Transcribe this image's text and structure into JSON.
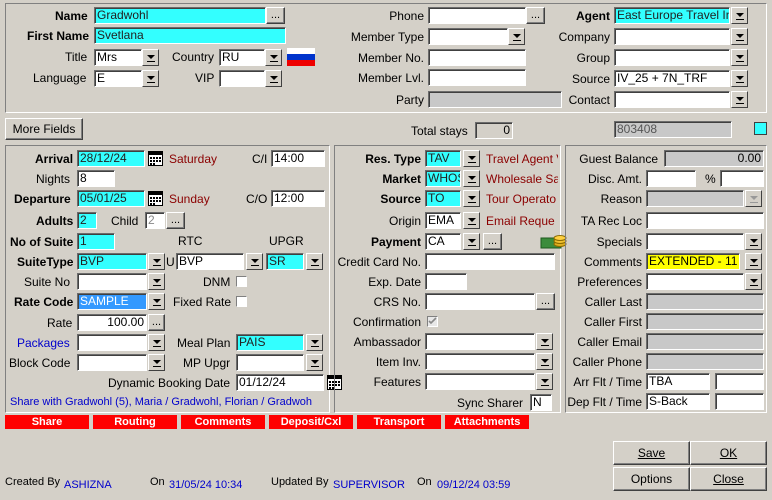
{
  "top": {
    "name_label": "Name",
    "name_value": "Gradwohl",
    "firstname_label": "First Name",
    "firstname_value": "Svetlana",
    "title_label": "Title",
    "title_value": "Mrs",
    "country_label": "Country",
    "country_value": "RU",
    "language_label": "Language",
    "language_value": "E",
    "vip_label": "VIP",
    "vip_value": "",
    "phone_label": "Phone",
    "phone_value": "",
    "membertype_label": "Member Type",
    "membertype_value": "",
    "memberno_label": "Member No.",
    "memberno_value": "",
    "memberlvl_label": "Member Lvl.",
    "memberlvl_value": "",
    "party_label": "Party",
    "party_value": "",
    "agent_label": "Agent",
    "agent_value": "East Europe Travel In",
    "company_label": "Company",
    "company_value": "",
    "group_label": "Group",
    "group_value": "",
    "source_label": "Source",
    "source_value": "IV_25 + 7N_TRF",
    "contact_label": "Contact",
    "contact_value": "",
    "ellipsis": "..."
  },
  "strip": {
    "more_fields": "More Fields",
    "total_stays_label": "Total stays",
    "total_stays_value": "0",
    "res_number": "803408"
  },
  "left": {
    "arrival_label": "Arrival",
    "arrival_value": "28/12/24",
    "arrival_day": "Saturday",
    "ci_label": "C/I",
    "ci_value": "14:00",
    "nights_label": "Nights",
    "nights_value": "8",
    "departure_label": "Departure",
    "departure_value": "05/01/25",
    "departure_day": "Sunday",
    "co_label": "C/O",
    "co_value": "12:00",
    "adults_label": "Adults",
    "adults_value": "2",
    "child_label": "Child",
    "child_value": "2",
    "noofsuite_label": "No of Suite",
    "noofsuite_value": "1",
    "rtc_label": "RTC",
    "upgr_label": "UPGR",
    "suitetype_label": "SuiteType",
    "suitetype_value": "BVP",
    "u_label": "U",
    "rtc_value": "BVP",
    "upgr_value": "SR",
    "suiteno_label": "Suite No",
    "suiteno_value": "",
    "dnm_label": "DNM",
    "ratecode_label": "Rate Code",
    "ratecode_value": "SAMPLE",
    "fixedrate_label": "Fixed Rate",
    "rate_label": "Rate",
    "rate_value": "100.00",
    "packages_label": "Packages",
    "packages_value": "",
    "mealplan_label": "Meal Plan",
    "mealplan_value": "PAIS",
    "blockcode_label": "Block Code",
    "blockcode_value": "",
    "mpupgr_label": "MP Upgr",
    "mpupgr_value": "",
    "dynbooking_label": "Dynamic Booking Date",
    "dynbooking_value": "01/12/24",
    "share_text": "Share with Gradwohl (5), Maria / Gradwohl, Florian / Gradwoh"
  },
  "middle": {
    "restype_label": "Res. Type",
    "restype_value": "TAV",
    "restype_desc": "Travel Agent V",
    "market_label": "Market",
    "market_value": "WHOS",
    "market_desc": "Wholesale Sa",
    "source_label": "Source",
    "source_value": "TO",
    "source_desc": "Tour Operato",
    "origin_label": "Origin",
    "origin_value": "EMA",
    "origin_desc": "Email Reque",
    "payment_label": "Payment",
    "payment_value": "CA",
    "creditcard_label": "Credit Card No.",
    "creditcard_value": "",
    "expdate_label": "Exp. Date",
    "expdate_value": "",
    "crsno_label": "CRS No.",
    "crsno_value": "",
    "confirmation_label": "Confirmation",
    "ambassador_label": "Ambassador",
    "ambassador_value": "",
    "iteminv_label": "Item Inv.",
    "iteminv_value": "",
    "features_label": "Features",
    "features_value": "",
    "syncsharer_label": "Sync Sharer",
    "syncsharer_value": "N"
  },
  "right": {
    "guestbalance_label": "Guest Balance",
    "guestbalance_value": "0.00",
    "discamt_label": "Disc. Amt.",
    "discamt_value": "",
    "pct_label": "%",
    "pct_value": "",
    "reason_label": "Reason",
    "reason_value": "",
    "tarecloc_label": "TA Rec Loc",
    "tarecloc_value": "",
    "specials_label": "Specials",
    "specials_value": "",
    "comments_label": "Comments",
    "comments_value": "EXTENDED - 11",
    "preferences_label": "Preferences",
    "preferences_value": "",
    "callerlast_label": "Caller Last",
    "callerfirst_label": "Caller First",
    "calleremail_label": "Caller Email",
    "callerphone_label": "Caller Phone",
    "arrflt_label": "Arr Flt / Time",
    "arrflt_value": "TBA",
    "arrtime_value": "",
    "depflt_label": "Dep Flt / Time",
    "depflt_value": "S-Back",
    "deptime_value": ""
  },
  "tabs": [
    "Share",
    "Routing",
    "Comments",
    "Deposit/Cxl",
    "Transport",
    "Attachments"
  ],
  "buttons": {
    "save": "Save",
    "ok": "OK",
    "options": "Options",
    "close": "Close"
  },
  "footer": {
    "createdby_label": "Created By",
    "createdby_value": "ASHIZNA",
    "on1_label": "On",
    "on1_value": "31/05/24 10:34",
    "updatedby_label": "Updated By",
    "updatedby_value": "SUPERVISOR",
    "on2_label": "On",
    "on2_value": "09/12/24 03:59"
  },
  "colors": {
    "field_cyan": "#33ffff",
    "desc_red": "#8b0000",
    "tab_red": "#ff0000",
    "link_blue": "#0000cc",
    "comment_yellow": "#ffff00"
  }
}
